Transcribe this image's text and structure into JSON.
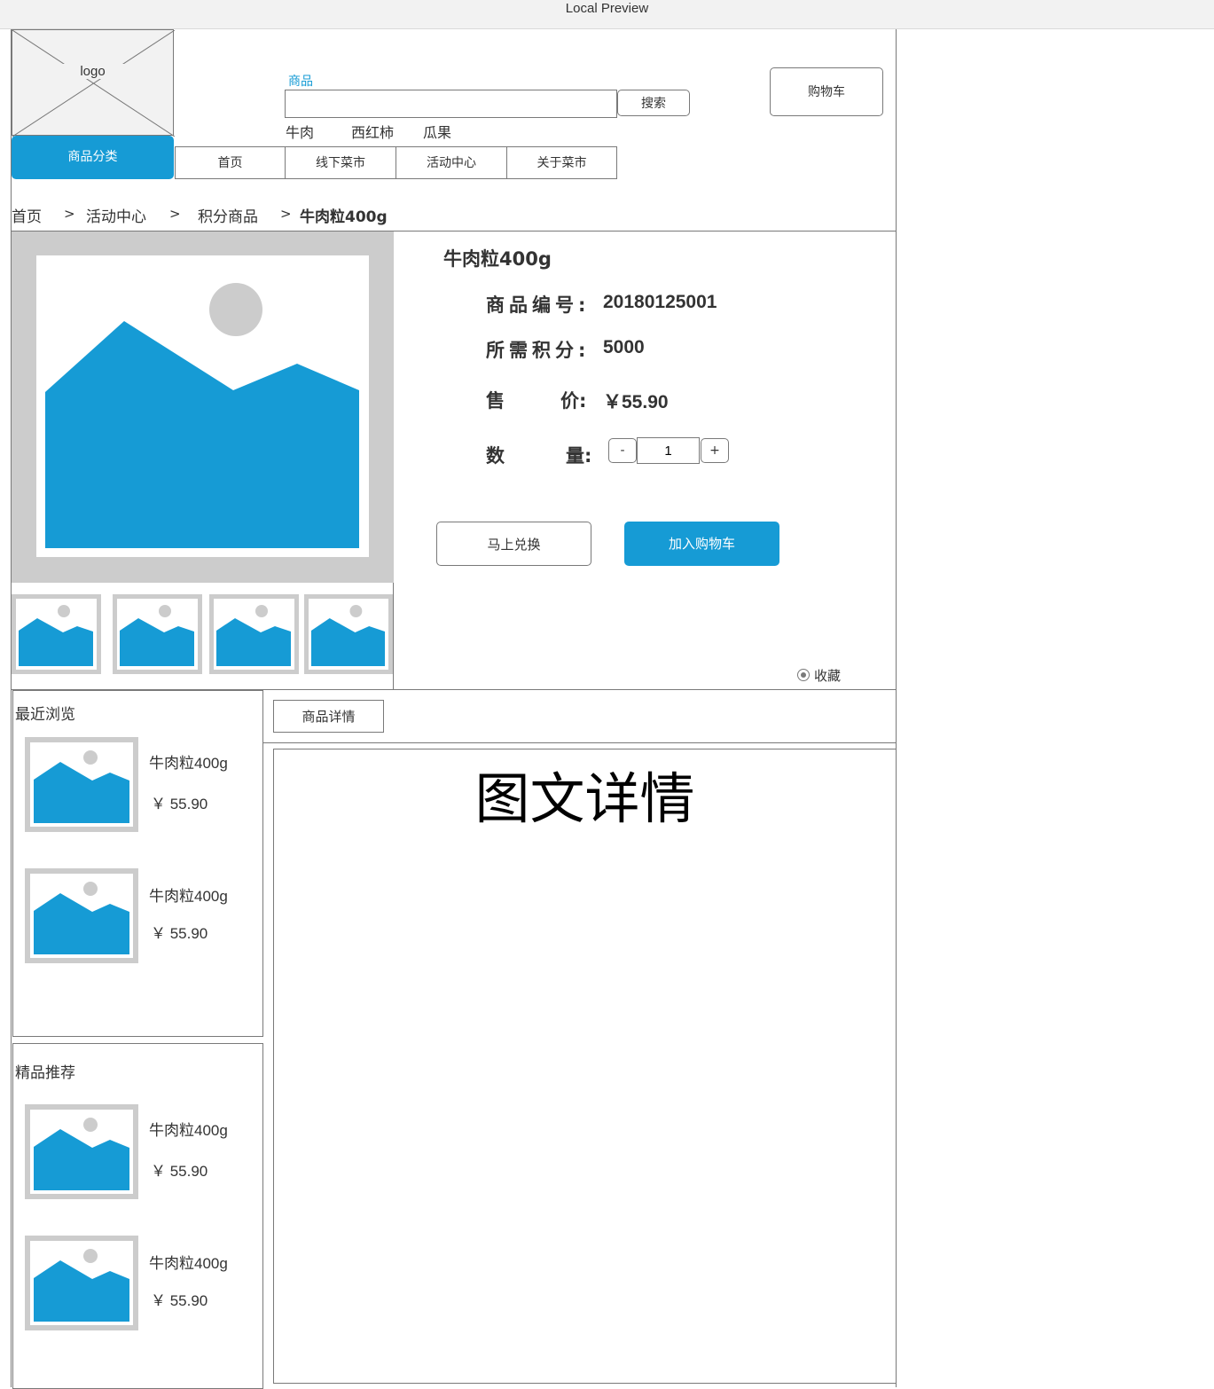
{
  "window": {
    "title": "Local Preview"
  },
  "header": {
    "logo_text": "logo",
    "search": {
      "label": "商品",
      "value": "",
      "button": "搜索"
    },
    "hot_keywords": [
      "牛肉",
      "西红柿",
      "瓜果"
    ],
    "cart_button": "购物车"
  },
  "nav": {
    "category_button": "商品分类",
    "items": [
      "首页",
      "线下菜市",
      "活动中心",
      "关于菜市"
    ]
  },
  "breadcrumb": {
    "items": [
      "首页",
      "活动中心",
      "积分商品",
      "牛肉粒400g"
    ],
    "separator": ">"
  },
  "product": {
    "name": "牛肉粒400g",
    "code_label": "商品编号:",
    "code": "20180125001",
    "points_label": "所需积分:",
    "points": "5000",
    "price_label_a": "售",
    "price_label_b": "价:",
    "price": "￥55.90",
    "qty_label_a": "数",
    "qty_label_b": "量:",
    "qty_minus": "-",
    "quantity": "1",
    "qty_plus": "+",
    "redeem_button": "马上兑换",
    "add_cart_button": "加入购物车",
    "favorite_label": "收藏",
    "image_placeholder_colors": {
      "frame": "#cccccc",
      "mountain": "#169bd5",
      "sun": "#cccccc"
    }
  },
  "sidebar": {
    "recent": {
      "title": "最近浏览",
      "items": [
        {
          "name": "牛肉粒400g",
          "price": "￥ 55.90"
        },
        {
          "name": "牛肉粒400g",
          "price": "￥ 55.90"
        }
      ]
    },
    "recommend": {
      "title": "精品推荐",
      "items": [
        {
          "name": "牛肉粒400g",
          "price": "￥ 55.90"
        },
        {
          "name": "牛肉粒400g",
          "price": "￥ 55.90"
        }
      ]
    }
  },
  "detail": {
    "tab": "商品详情",
    "content_title": "图文详情"
  },
  "colors": {
    "accent": "#169bd5",
    "border": "#797979",
    "placeholder": "#cccccc"
  }
}
